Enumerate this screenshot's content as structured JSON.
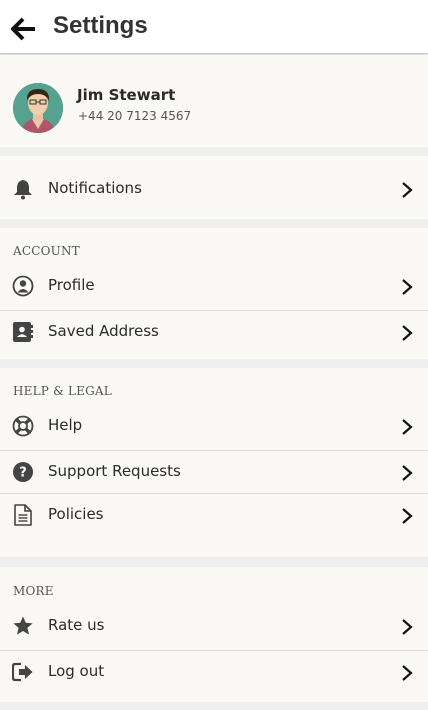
{
  "header": {
    "title": "Settings"
  },
  "profile": {
    "name": "Jim Stewart",
    "phone": "+44 20 7123 4567"
  },
  "notifications": {
    "label": "Notifications"
  },
  "account": {
    "title": "ACCOUNT",
    "items": [
      {
        "label": "Profile"
      },
      {
        "label": "Saved Address"
      }
    ]
  },
  "help": {
    "title": "HELP & LEGAL",
    "items": [
      {
        "label": "Help"
      },
      {
        "label": "Support Requests"
      },
      {
        "label": "Policies"
      }
    ]
  },
  "more": {
    "title": "MORE",
    "items": [
      {
        "label": "Rate us"
      },
      {
        "label": "Log out"
      }
    ]
  }
}
